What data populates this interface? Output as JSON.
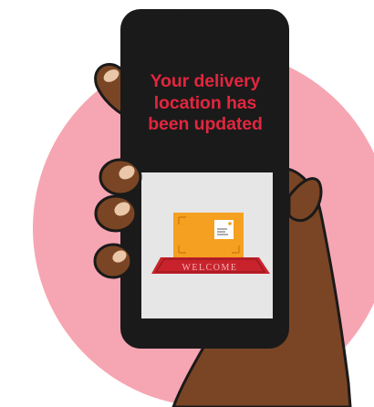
{
  "screen": {
    "message": "Your delivery location has been updated"
  },
  "illustration": {
    "mat_text": "WELCOME",
    "colors": {
      "background_circle": "#f6a6b2",
      "skin": "#7a4524",
      "nail": "#e9c7a8",
      "phone_frame": "#1a1a1a",
      "message_text": "#e2263e",
      "package": "#f5a020",
      "mat": "#c8232c",
      "image_panel": "#e6e6e6"
    }
  }
}
